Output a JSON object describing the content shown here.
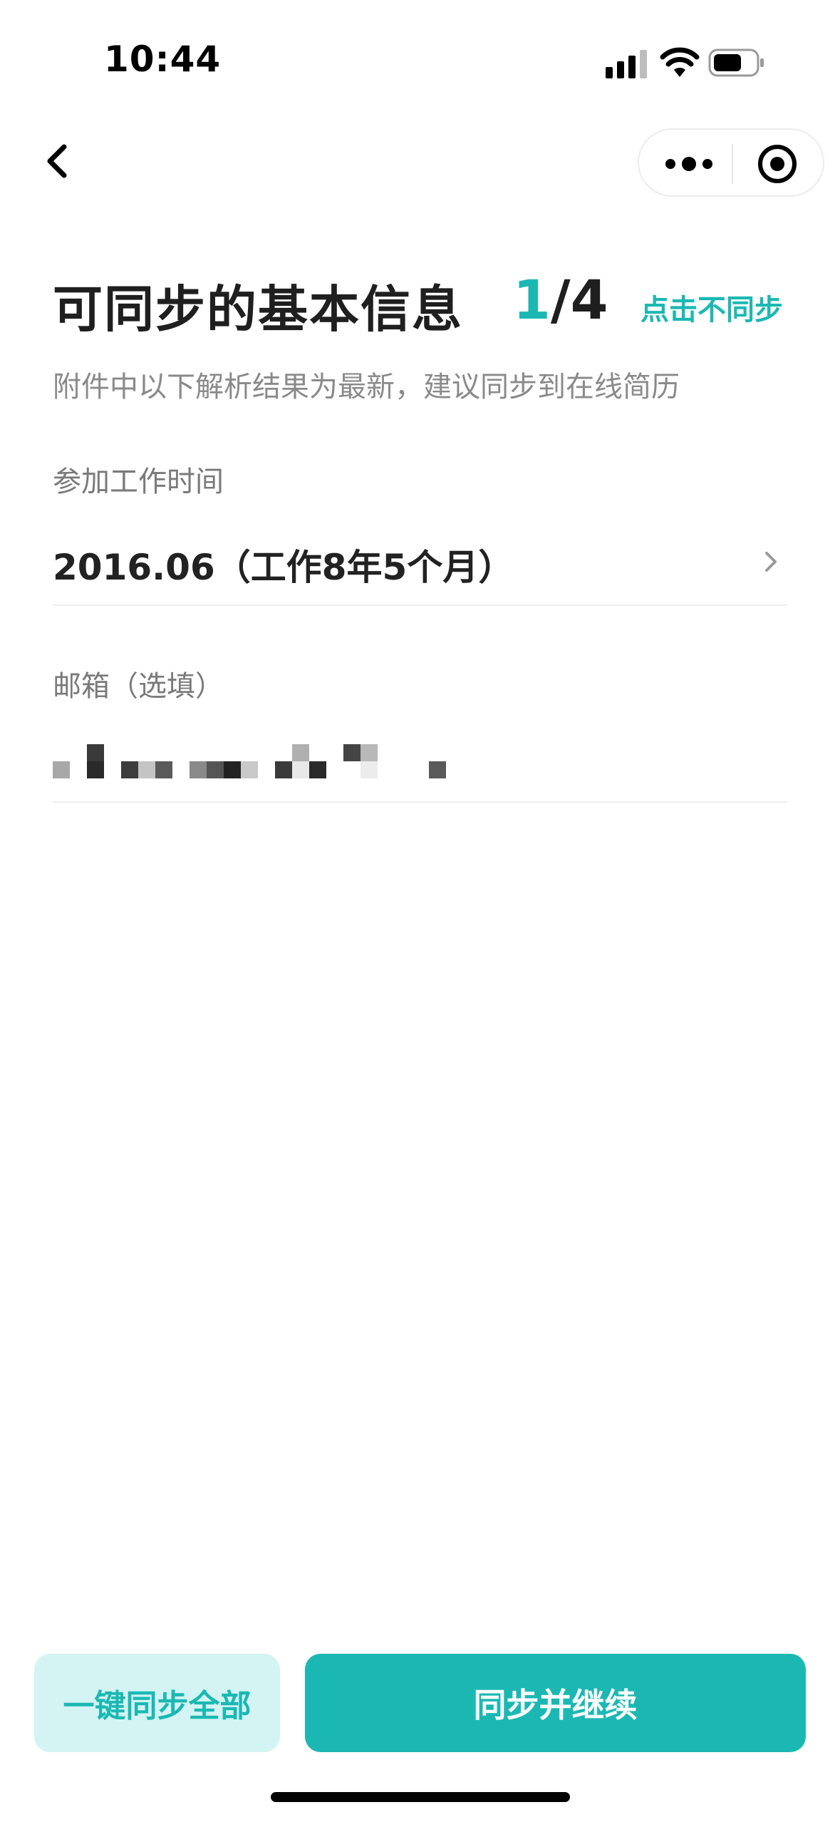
{
  "status_bar": {
    "time": "10:44",
    "icons": [
      "signal-icon",
      "wifi-icon",
      "battery-icon"
    ]
  },
  "nav": {
    "back_icon": "chevron-left-icon",
    "more_icon": "more-dots-icon",
    "close_icon": "target-circle-icon"
  },
  "header": {
    "title": "可同步的基本信息",
    "progress_current": "1",
    "progress_total": "/4",
    "skip_label": "点击不同步",
    "subtitle": "附件中以下解析结果为最新，建议同步到在线简历"
  },
  "fields": {
    "work_start": {
      "label": "参加工作时间",
      "value": "2016.06（工作8年5个月）"
    },
    "email": {
      "label": "邮箱（选填）"
    }
  },
  "buttons": {
    "sync_all": "一键同步全部",
    "sync_continue": "同步并继续"
  },
  "colors": {
    "accent": "#1bb8b3",
    "accent_light": "#d3f4f3",
    "text_primary": "#1f1f1f",
    "text_secondary": "#8a8a8a"
  }
}
